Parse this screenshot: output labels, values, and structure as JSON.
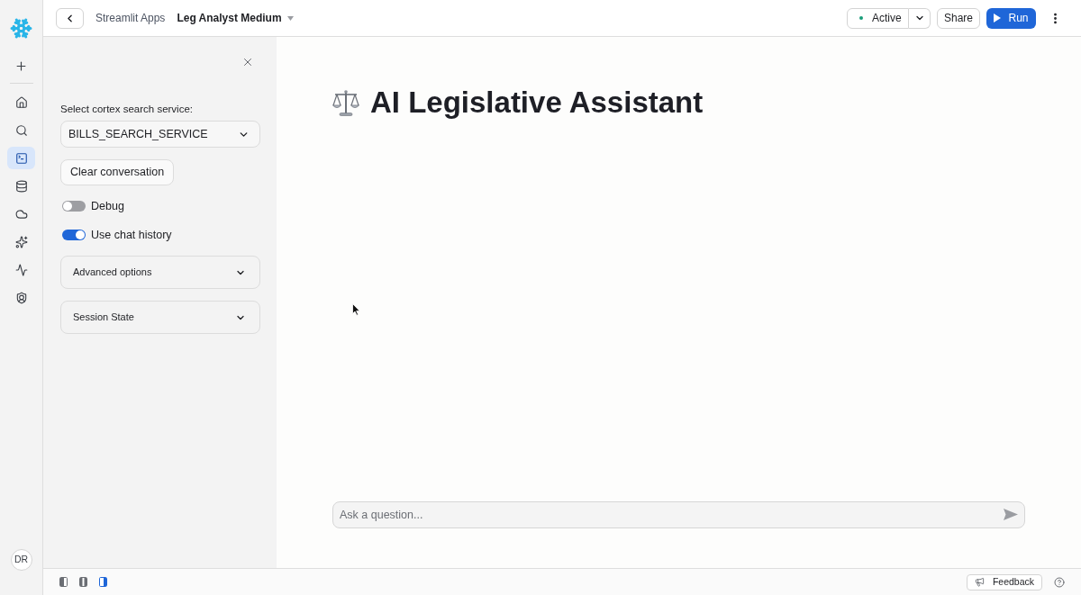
{
  "nav": {
    "items": [
      {
        "kind": "home",
        "selected": false
      },
      {
        "kind": "search",
        "selected": false
      },
      {
        "kind": "terminal",
        "selected": true
      },
      {
        "kind": "database",
        "selected": false
      },
      {
        "kind": "cloud",
        "selected": false
      },
      {
        "kind": "sparkles",
        "selected": false
      },
      {
        "kind": "activity",
        "selected": false
      },
      {
        "kind": "shield",
        "selected": false
      }
    ],
    "avatar": "DR"
  },
  "header": {
    "breadcrumb": "Streamlit Apps",
    "app_name": "Leg Analyst Medium",
    "status": "Active",
    "share": "Share",
    "run": "Run"
  },
  "sidebar": {
    "select_label": "Select cortex search service:",
    "select_value": "BILLS_SEARCH_SERVICE",
    "clear_button": "Clear conversation",
    "toggles": [
      {
        "label": "Debug",
        "on": false
      },
      {
        "label": "Use chat history",
        "on": true
      }
    ],
    "expanders": [
      {
        "label": "Advanced options",
        "expanded": false
      },
      {
        "label": "Session State",
        "expanded": false
      }
    ]
  },
  "main": {
    "title": "AI Legislative Assistant",
    "chat_input": {
      "placeholder": "Ask a question..."
    }
  },
  "footer": {
    "layouts": [
      {
        "kind": "left",
        "selected": false
      },
      {
        "kind": "split",
        "selected": false
      },
      {
        "kind": "right",
        "selected": true
      }
    ],
    "feedback": "Feedback"
  }
}
